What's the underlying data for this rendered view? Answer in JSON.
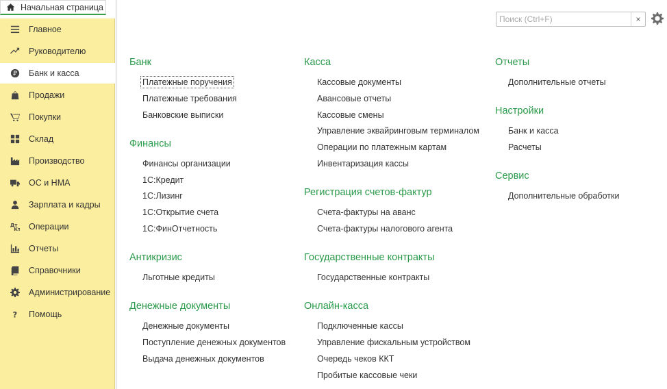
{
  "tab": {
    "label": "Начальная страница"
  },
  "sidebar": {
    "items": [
      {
        "label": "Главное",
        "icon": "menu-lines-icon"
      },
      {
        "label": "Руководителю",
        "icon": "trend-icon"
      },
      {
        "label": "Банк и касса",
        "icon": "ruble-coin-icon",
        "active": true
      },
      {
        "label": "Продажи",
        "icon": "shopping-bag-icon"
      },
      {
        "label": "Покупки",
        "icon": "cart-icon"
      },
      {
        "label": "Склад",
        "icon": "warehouse-grid-icon"
      },
      {
        "label": "Производство",
        "icon": "factory-icon"
      },
      {
        "label": "ОС и НМА",
        "icon": "truck-icon"
      },
      {
        "label": "Зарплата и кадры",
        "icon": "person-icon"
      },
      {
        "label": "Операции",
        "icon": "debit-credit-icon"
      },
      {
        "label": "Отчеты",
        "icon": "bar-chart-icon"
      },
      {
        "label": "Справочники",
        "icon": "book-icon"
      },
      {
        "label": "Администрирование",
        "icon": "gear-icon"
      },
      {
        "label": "Помощь",
        "icon": "question-icon"
      }
    ]
  },
  "search": {
    "placeholder": "Поиск (Ctrl+F)",
    "value": "",
    "clear_label": "×"
  },
  "columns": [
    {
      "sections": [
        {
          "title": "Банк",
          "links": [
            "Платежные поручения",
            "Платежные требования",
            "Банковские выписки"
          ]
        },
        {
          "title": "Финансы",
          "links": [
            "Финансы организации",
            "1С:Кредит",
            "1С:Лизинг",
            "1С:Открытие счета",
            "1С:ФинОтчетность"
          ]
        },
        {
          "title": "Антикризис",
          "links": [
            "Льготные кредиты"
          ]
        },
        {
          "title": "Денежные документы",
          "links": [
            "Денежные документы",
            "Поступление денежных документов",
            "Выдача денежных документов"
          ]
        }
      ]
    },
    {
      "sections": [
        {
          "title": "Касса",
          "links": [
            "Кассовые документы",
            "Авансовые отчеты",
            "Кассовые смены",
            "Управление эквайринговым терминалом",
            "Операции по платежным картам",
            "Инвентаризация кассы"
          ]
        },
        {
          "title": "Регистрация счетов-фактур",
          "links": [
            "Счета-фактуры на аванс",
            "Счета-фактуры налогового агента"
          ]
        },
        {
          "title": "Государственные контракты",
          "links": [
            "Государственные контракты"
          ]
        },
        {
          "title": "Онлайн-касса",
          "links": [
            "Подключенные кассы",
            "Управление фискальным устройством",
            "Очередь чеков ККТ",
            "Пробитые кассовые чеки"
          ]
        }
      ]
    },
    {
      "sections": [
        {
          "title": "Отчеты",
          "links": [
            "Дополнительные отчеты"
          ]
        },
        {
          "title": "Настройки",
          "links": [
            "Банк и касса",
            "Расчеты"
          ]
        },
        {
          "title": "Сервис",
          "links": [
            "Дополнительные обработки"
          ]
        }
      ]
    }
  ],
  "colors": {
    "accent_green": "#2a9a4a",
    "sidebar_bg": "#fbee9e"
  }
}
